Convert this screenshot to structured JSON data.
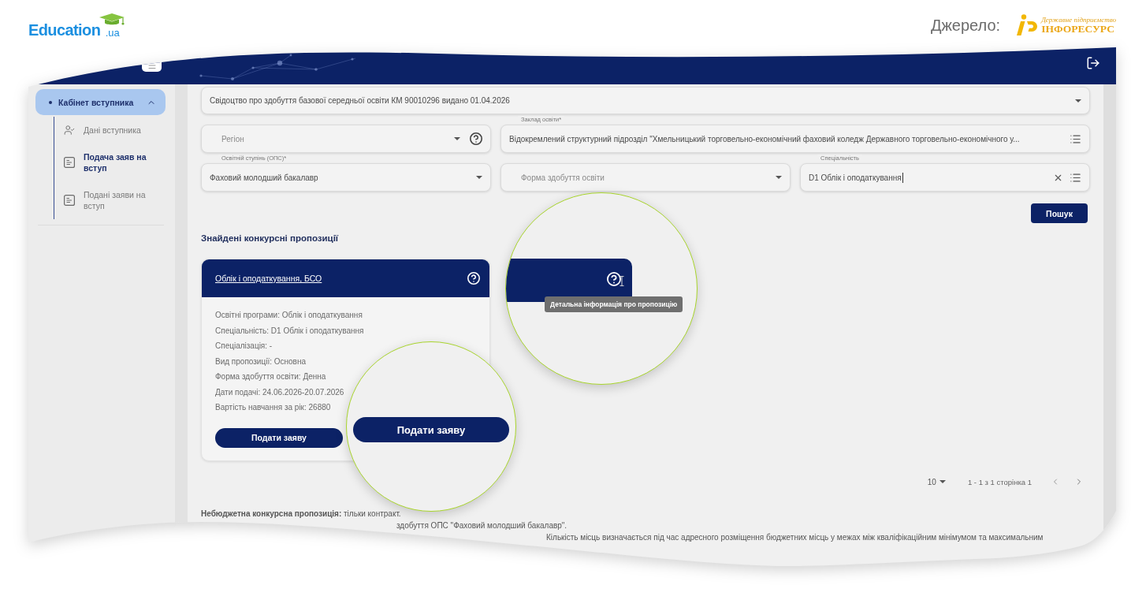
{
  "branding": {
    "site_name": "Education",
    "site_suffix": ".ua",
    "source_label": "Джерело:",
    "source_tagline": "Державне підприємство",
    "source_name": "ІНФОРЕСУРС"
  },
  "sidebar": {
    "section": {
      "label": "Кабінет вступника",
      "selected": true,
      "expanded": true
    },
    "items": [
      {
        "kind": "profile",
        "label": "Дані вступника",
        "selected": false
      },
      {
        "kind": "form",
        "label": "Подача заяв на вступ",
        "selected": true
      },
      {
        "kind": "form",
        "label": "Подані заяви на вступ",
        "selected": false
      }
    ]
  },
  "filters": {
    "document": {
      "value": "Свідоцтво про здобуття базової середньої освіти КМ 90010296 видано 01.04.2026"
    },
    "region": {
      "placeholder": "Регіон"
    },
    "institution": {
      "label": "Заклад освіти*",
      "value": "Відокремлений структурний підрозділ \"Хмельницький торговельно-економічний фаховий коледж Державного торговельно-економічного у..."
    },
    "level": {
      "label": "Освітній ступінь (ОПС)*",
      "value": "Фаховий молодший бакалавр"
    },
    "study_form": {
      "placeholder": "Форма здобуття освіти"
    },
    "specialty": {
      "label": "Спеціальність",
      "value": "D1 Облік і оподаткування",
      "focused": true
    },
    "search_button": "Пошук"
  },
  "results": {
    "title": "Знайдені конкурсні пропозиції",
    "offers": [
      {
        "title": "Облік і оподаткування, БСО",
        "details": [
          "Освітні програми: Облік і оподаткування",
          "Спеціальність: D1 Облік і оподаткування",
          "Спеціалізація: -",
          "Вид пропозиції: Основна",
          "Форма здобуття освіти: Денна",
          "Дати подачі: 24.06.2026-20.07.2026",
          "Вартість навчання за рік: 26880"
        ],
        "apply_button": "Подати заяву"
      }
    ]
  },
  "pagination": {
    "page_size": "10",
    "range": "1 - 1 з 1 сторінка 1"
  },
  "notes": [
    "**Небюджетна конкурсна пропозиція:** тільки контракт.",
    "здобуття ОПС \"Фаховий молодший бакалавр\".",
    "Кількість місць визначається під час адресного розміщення бюджетних місць у межах між кваліфікаційним мінімумом та максимальним"
  ],
  "callouts": [
    {
      "kind": "button",
      "label": "Подати заяву"
    },
    {
      "kind": "tooltip",
      "label": "Детальна інформація про пропозицію"
    }
  ]
}
